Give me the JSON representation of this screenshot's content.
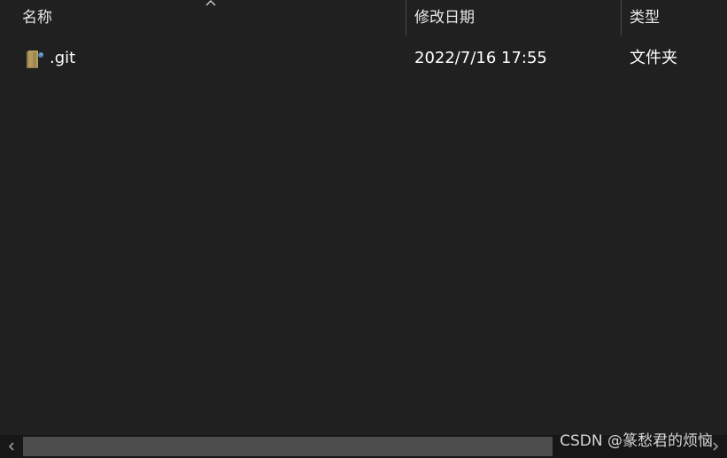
{
  "columns": {
    "name": "名称",
    "date_modified": "修改日期",
    "type": "类型"
  },
  "rows": [
    {
      "name": ".git",
      "date_modified": "2022/7/16 17:55",
      "type": "文件夹",
      "icon": "git-folder-icon"
    }
  ],
  "sort": {
    "column": "name",
    "direction": "ascending"
  },
  "watermark": "CSDN @篆愁君的烦恼",
  "colors": {
    "background": "#202020",
    "text": "#ffffff",
    "scrollbar_thumb": "#4d4d4d"
  }
}
